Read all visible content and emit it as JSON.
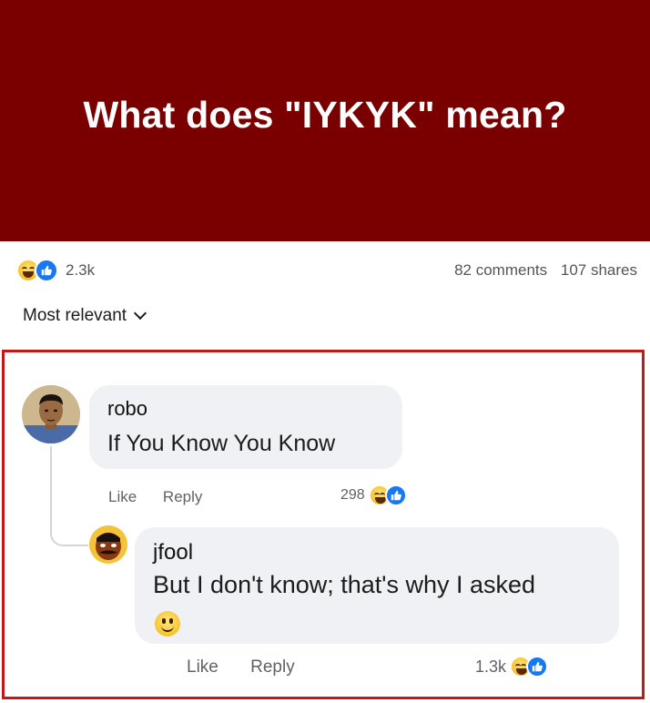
{
  "banner": {
    "title": "What does \"IYKYK\" mean?"
  },
  "post_stats": {
    "reaction_icons": [
      "haha-icon",
      "like-icon"
    ],
    "reaction_count": "2.3k",
    "comments": "82 comments",
    "shares": "107 shares"
  },
  "sort": {
    "label": "Most relevant"
  },
  "comments": [
    {
      "author": "robo",
      "text": "If You Know You Know",
      "actions": {
        "like": "Like",
        "reply": "Reply"
      },
      "reaction_count": "298",
      "reaction_icons": [
        "haha-icon",
        "like-icon"
      ]
    },
    {
      "author": "jfool",
      "text": "But I don't know; that's why I asked",
      "emoji": "smile-emoji",
      "actions": {
        "like": "Like",
        "reply": "Reply"
      },
      "reaction_count": "1.3k",
      "reaction_icons": [
        "haha-icon",
        "like-icon"
      ]
    }
  ],
  "colors": {
    "banner_bg": "#7a0000",
    "highlight_border": "#c11818",
    "like_blue": "#1877f2",
    "bubble_bg": "#f0f1f4"
  }
}
